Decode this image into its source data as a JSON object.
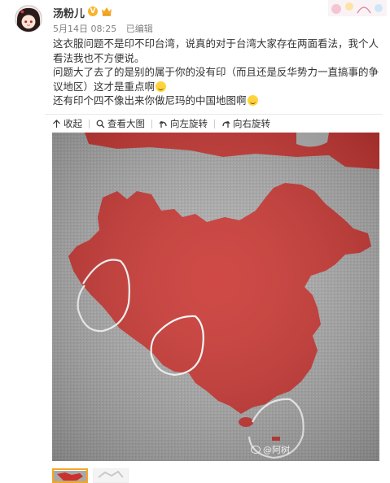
{
  "user": {
    "name": "汤粉儿",
    "badge": "V"
  },
  "meta": {
    "date": "5月14日 08:25",
    "edited": "已编辑"
  },
  "post": {
    "lines": [
      "这衣服问题不是印不印台湾，说真的对于台湾大家存在两面看法，我个人看法我也不方便说。",
      "问题大了去了的是别的属于你的没有印（而且还是反华势力一直搞事的争议地区）这才是重点啊",
      "还有印个四不像出来你做尼玛的中国地图啊"
    ]
  },
  "toolbar": {
    "collapse": "收起",
    "view_large": "查看大图",
    "rotate_left": "向左旋转",
    "rotate_right": "向右旋转"
  },
  "image": {
    "watermark": "@阿树"
  },
  "colors": {
    "shirt_gray": "#a6a6a6",
    "print_red": "#c9322e",
    "accent_orange": "#f5a623"
  }
}
